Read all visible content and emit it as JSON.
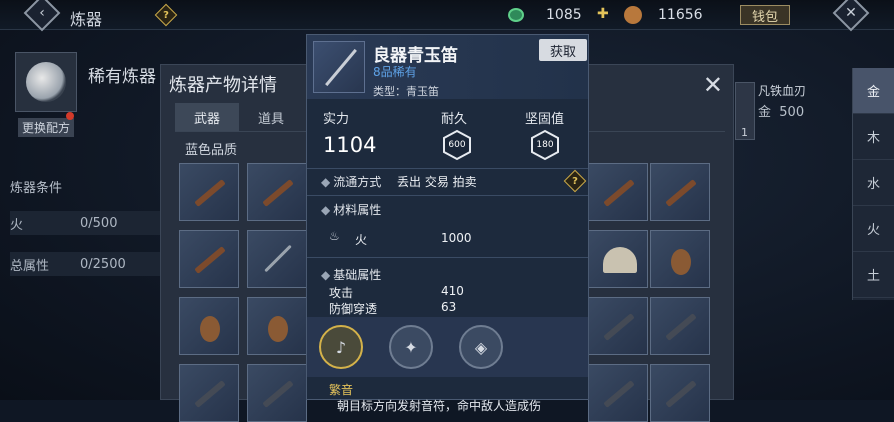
{
  "topbar": {
    "title": "炼器",
    "jade_amount": "1085",
    "gourd_amount": "11656",
    "money_bag_label": "钱包"
  },
  "left": {
    "rare_title": "稀有炼器",
    "change_recipe": "更换配方",
    "conditions_title": "炼器条件",
    "conditions": [
      {
        "key": "火",
        "value": "0/500"
      },
      {
        "key": "总属性",
        "value": "0/2500"
      }
    ]
  },
  "panel": {
    "title": "炼器产物详情",
    "tabs": [
      "武器",
      "道具"
    ],
    "quality_label": "蓝色品质",
    "close_symbol": "✕"
  },
  "right_item": {
    "name": "凡铁血刃",
    "element": "金",
    "value": "500",
    "count": "1"
  },
  "elements": [
    "金",
    "木",
    "水",
    "火",
    "土"
  ],
  "tooltip": {
    "name": "良器青玉笛",
    "grade": "8品稀有",
    "type_label": "类型：青玉笛",
    "get_button": "获取",
    "power_label": "实力",
    "power_value": "1104",
    "durability_label": "耐久",
    "durability_value": "600",
    "solidity_label": "坚固值",
    "solidity_value": "180",
    "circulation_label": "流通方式",
    "circulation_value": "丢出 交易 拍卖",
    "material_title": "材料属性",
    "material_key": "火",
    "material_value": "1000",
    "base_title": "基础属性",
    "attack_label": "攻击",
    "attack_value": "410",
    "pierce_label": "防御穿透",
    "pierce_value": "63",
    "skill_name": "繁音",
    "skill_desc": "朝目标方向发射音符，命中敌人造成伤"
  }
}
